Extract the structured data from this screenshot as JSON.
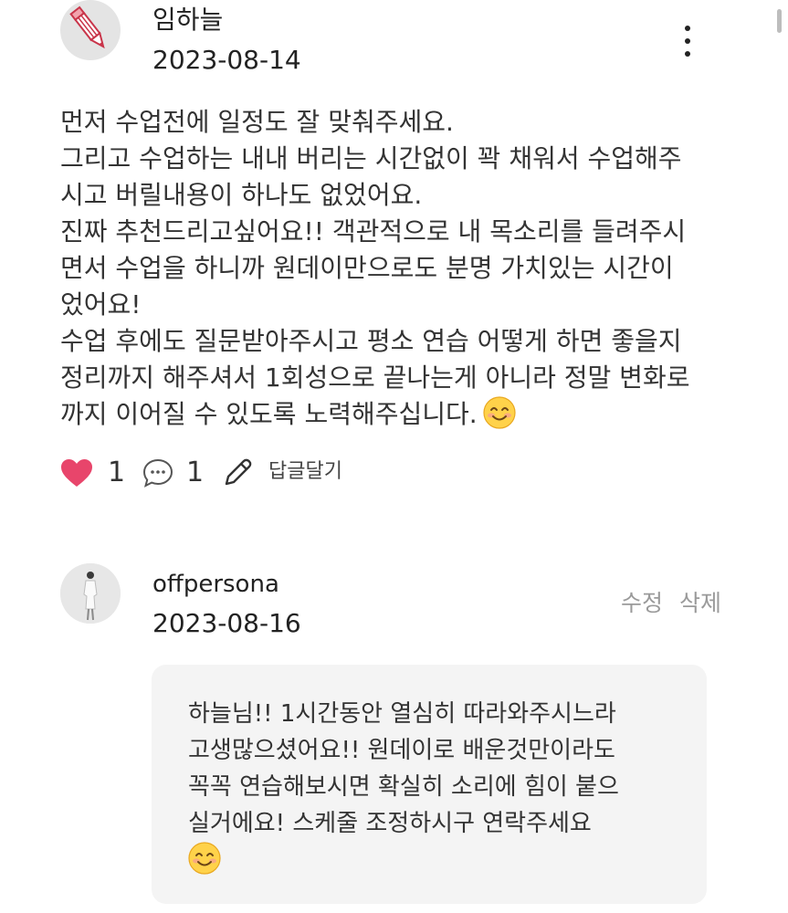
{
  "review": {
    "author": "임하늘",
    "date": "2023-08-14",
    "avatar_icon": "pencil-icon",
    "more_icon": "more-vertical-icon",
    "body_lines": [
      "먼저 수업전에 일정도 잘 맞춰주세요.",
      "그리고 수업하는 내내 버리는 시간없이 꽉 채워서 수업해주",
      "시고 버릴내용이 하나도 없었어요.",
      "진짜 추천드리고싶어요!! 객관적으로 내 목소리를 들려주시",
      "면서 수업을 하니까 원데이만으로도 분명 가치있는 시간이",
      "었어요!",
      "수업 후에도 질문받아주시고 평소 연습 어떻게 하면 좋을지",
      "정리까지 해주셔서 1회성으로 끝나는게 아니라 정말 변화로",
      "까지 이어질 수 있도록 노력해주십니다."
    ],
    "body_emoji": "smiling-face-emoji"
  },
  "actions": {
    "like_icon": "heart-icon",
    "like_count": "1",
    "comment_icon": "comment-bubble-icon",
    "comment_count": "1",
    "reply_icon": "pencil-icon",
    "reply_label": "답글달기"
  },
  "owner_reply": {
    "author": "offpersona",
    "date": "2023-08-16",
    "edit_label": "수정",
    "delete_label": "삭제",
    "text_lines": [
      "하늘님!! 1시간동안 열심히 따라와주시느라",
      "고생많으셨어요!! 원데이로 배운것만이라도",
      "꼭꼭 연습해보시면 확실히 소리에 힘이 붙으",
      "실거에요! 스케줄 조정하시구 연락주세요"
    ],
    "text_emoji": "smiling-face-emoji"
  },
  "colors": {
    "heart": "#e8456b",
    "text": "#222222",
    "muted": "#9a9a9a",
    "bubble": "#f4f4f4",
    "avatar_bg": "#e4e4e4"
  }
}
